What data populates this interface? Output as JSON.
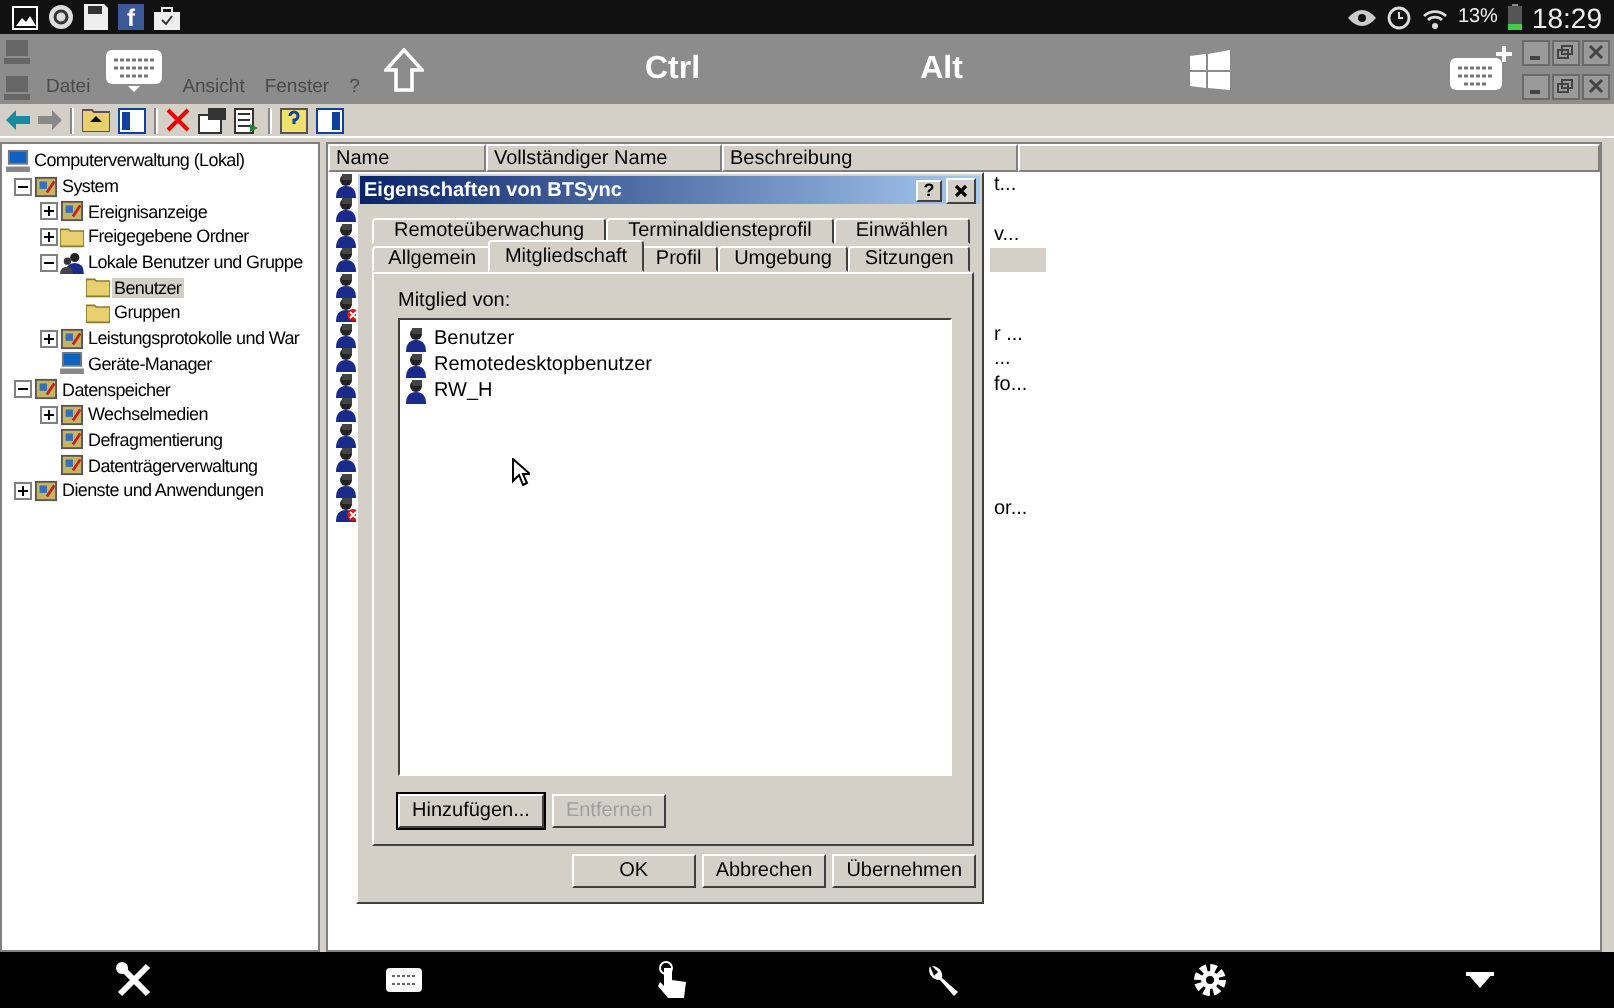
{
  "status_bar": {
    "app_letter": "f",
    "battery": "13%",
    "time": "18:29"
  },
  "remote_keys": [
    {
      "kind": "keyboard"
    },
    {
      "kind": "shift"
    },
    {
      "kind": "text",
      "label": "Ctrl"
    },
    {
      "kind": "text",
      "label": "Alt"
    },
    {
      "kind": "windows"
    },
    {
      "kind": "keyboard_plus"
    }
  ],
  "menu": [
    "Datei",
    "Ansicht",
    "Fenster",
    "?"
  ],
  "tree": [
    {
      "label": "Computerverwaltung (Lokal)",
      "kind": "computer",
      "selected": false,
      "children": [
        {
          "label": "System",
          "kind": "tool",
          "selected": false,
          "expanded": true,
          "children": [
            {
              "label": "Ereignisanzeige",
              "kind": "tool",
              "selected": false,
              "expanded": false
            },
            {
              "label": "Freigegebene Ordner",
              "kind": "folder",
              "selected": false,
              "expanded": false
            },
            {
              "label": "Lokale Benutzer und Gruppe",
              "kind": "users",
              "selected": false,
              "expanded": true,
              "children": [
                {
                  "label": "Benutzer",
                  "kind": "folder",
                  "selected": true
                },
                {
                  "label": "Gruppen",
                  "kind": "folder",
                  "selected": false
                }
              ]
            },
            {
              "label": "Leistungsprotokolle und War",
              "kind": "tool",
              "selected": false,
              "expanded": false
            },
            {
              "label": "Geräte-Manager",
              "kind": "computer",
              "selected": false
            }
          ]
        },
        {
          "label": "Datenspeicher",
          "kind": "tool",
          "selected": false,
          "expanded": true,
          "children": [
            {
              "label": "Wechselmedien",
              "kind": "tool",
              "selected": false,
              "expanded": false
            },
            {
              "label": "Defragmentierung",
              "kind": "tool",
              "selected": false
            },
            {
              "label": "Datenträgerverwaltung",
              "kind": "tool",
              "selected": false
            }
          ]
        },
        {
          "label": "Dienste und Anwendungen",
          "kind": "tool",
          "selected": false,
          "expanded": false
        }
      ]
    }
  ],
  "list": {
    "columns": [
      "Name",
      "Vollständiger Name",
      "Beschreibung"
    ],
    "rows": [
      {
        "kind": "user",
        "selected": false,
        "description": "t..."
      },
      {
        "kind": "user",
        "selected": false
      },
      {
        "kind": "user",
        "selected": false,
        "description": "v..."
      },
      {
        "kind": "user",
        "selected": true
      },
      {
        "kind": "user",
        "selected": false
      },
      {
        "kind": "disabled_user",
        "selected": false
      },
      {
        "kind": "user",
        "selected": false,
        "description": "r ..."
      },
      {
        "kind": "user",
        "selected": false,
        "description": "..."
      },
      {
        "kind": "user",
        "selected": false,
        "description": "fo..."
      },
      {
        "kind": "user",
        "selected": false
      },
      {
        "kind": "user",
        "selected": false
      },
      {
        "kind": "user",
        "selected": false
      },
      {
        "kind": "user",
        "selected": false
      },
      {
        "kind": "disabled_user",
        "selected": false,
        "description": "or..."
      }
    ]
  },
  "dialog": {
    "title": "Eigenschaften von BTSync",
    "help": "?",
    "tabs_back": [
      {
        "label": "Remoteüberwachung",
        "selected": false
      },
      {
        "label": "Terminaldiensteprofil",
        "selected": false
      },
      {
        "label": "Einwählen",
        "selected": false
      }
    ],
    "tabs_front": [
      {
        "label": "Allgemein",
        "selected": false
      },
      {
        "label": "Mitgliedschaft",
        "selected": true
      },
      {
        "label": "Profil",
        "selected": false
      },
      {
        "label": "Umgebung",
        "selected": false
      },
      {
        "label": "Sitzungen",
        "selected": false
      }
    ],
    "members_label": "Mitglied von:",
    "members": [
      "Benutzer",
      "Remotedesktopbenutzer",
      "RW_H"
    ],
    "list_buttons": [
      {
        "label": "Hinzufügen...",
        "disabled": false
      },
      {
        "label": "Entfernen",
        "disabled": true
      }
    ],
    "buttons": [
      "OK",
      "Abbrechen",
      "Übernehmen"
    ]
  }
}
